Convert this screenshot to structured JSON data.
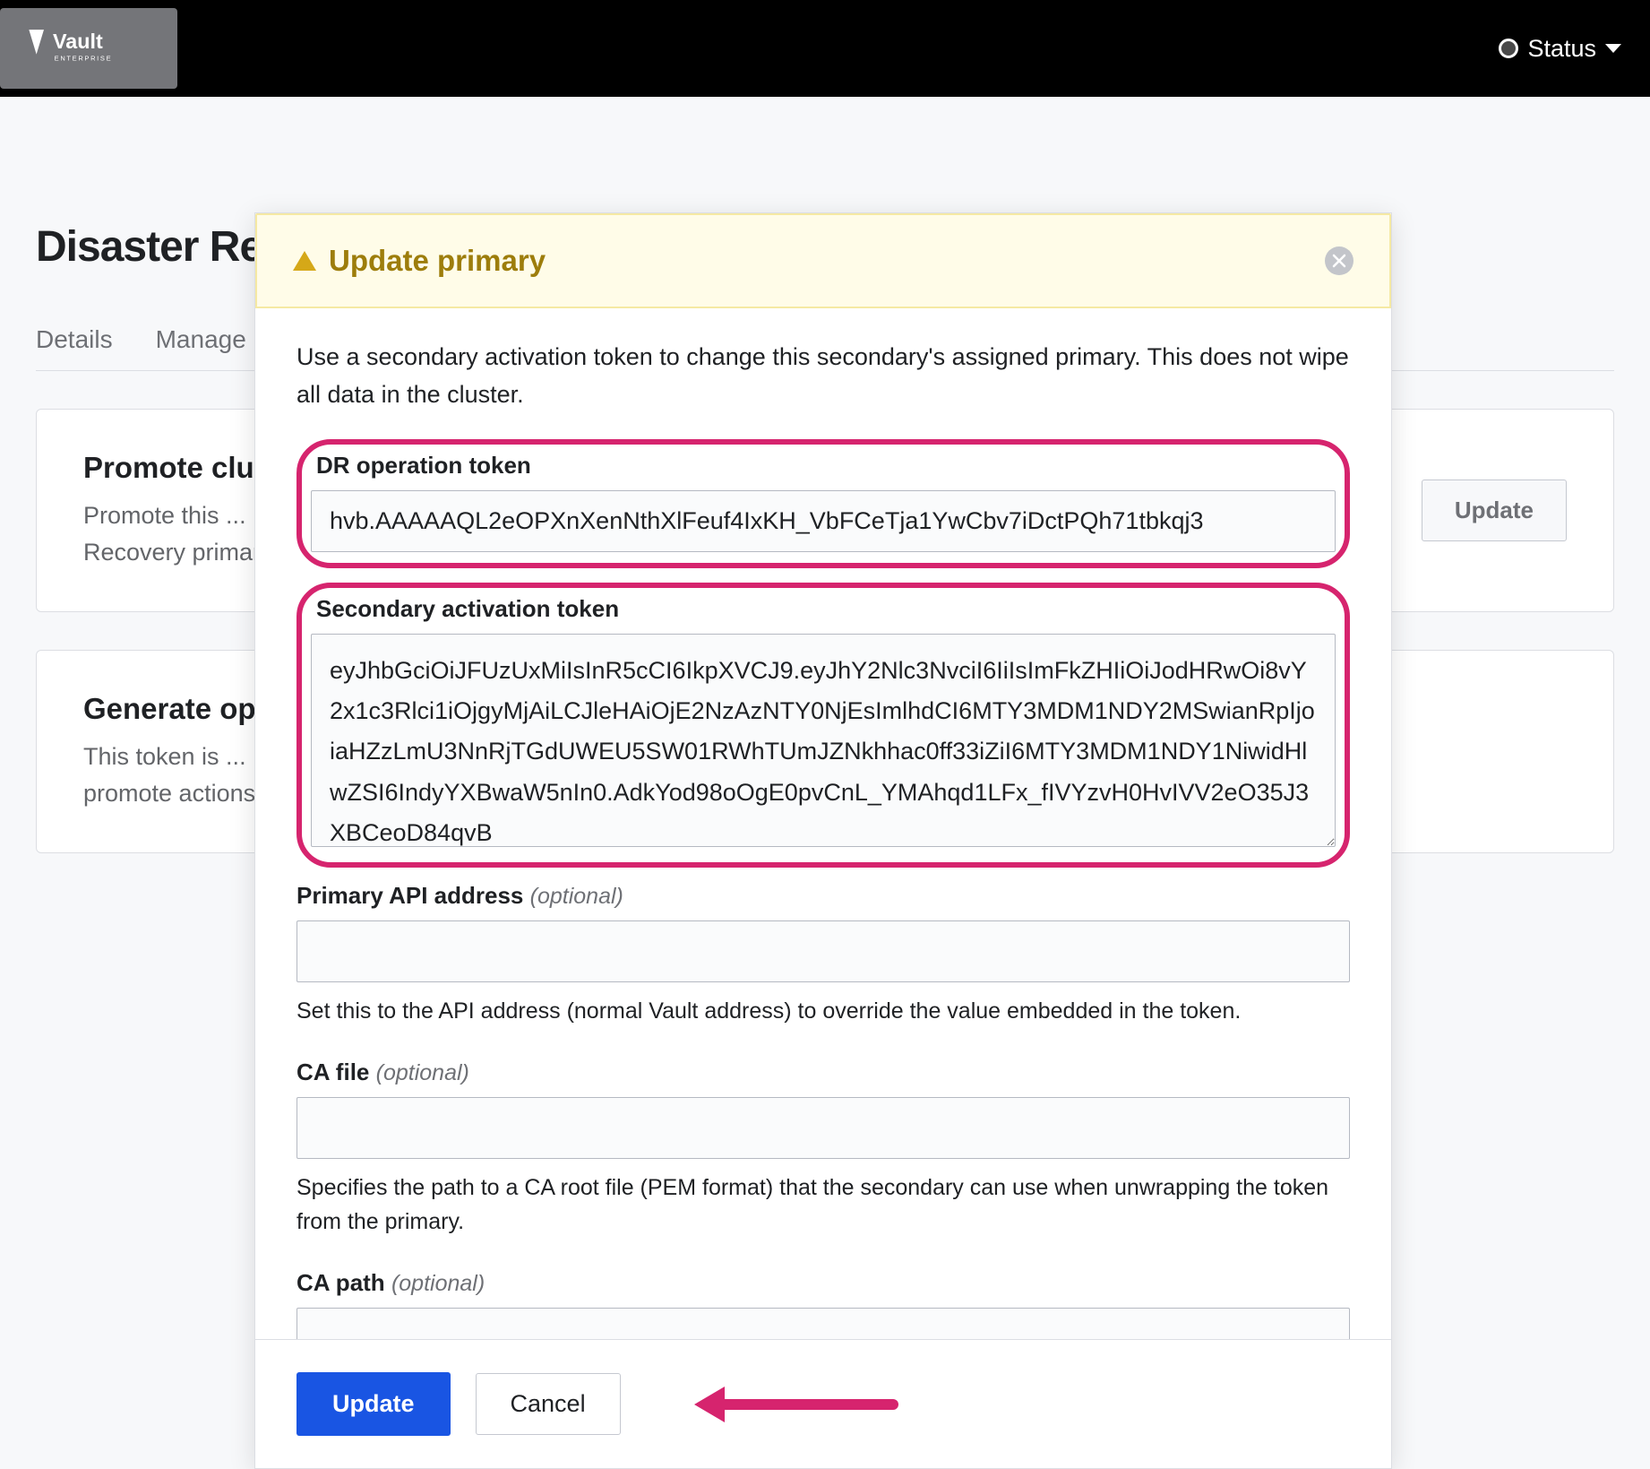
{
  "header": {
    "product": "Vault",
    "subproduct": "ENTERPRISE",
    "status_label": "Status"
  },
  "page": {
    "title": "Disaster Recovery",
    "tabs": [
      "Details",
      "Manage"
    ],
    "cards": [
      {
        "title": "Promote cluster",
        "desc1": "Promote this ...",
        "desc2": "Recovery primary",
        "button": "Update"
      },
      {
        "title": "Generate operation token",
        "desc1": "This token is ...",
        "desc2": "promote actions"
      }
    ]
  },
  "modal": {
    "title": "Update primary",
    "description": "Use a secondary activation token to change this secondary's assigned primary. This does not wipe all data in the cluster.",
    "fields": {
      "dr_token": {
        "label": "DR operation token",
        "value": "hvb.AAAAAQL2eOPXnXenNthXlFeuf4IxKH_VbFCeTja1YwCbv7iDctPQh71tbkqj3"
      },
      "secondary_token": {
        "label": "Secondary activation token",
        "value": "eyJhbGciOiJFUzUxMiIsInR5cCI6IkpXVCJ9.eyJhY2Nlc3NvciI6IiIsImFkZHIiOiJodHRwOi8vY2x1c3Rlci1iOjgyMjAiLCJleHAiOjE2NzAzNTY0NjEsImlhdCI6MTY3MDM1NDY2MSwianRpIjoiaHZzLmU3NnRjTGdUWEU5SW01RWhTUmJZNkhhac0ff33iZiI6MTY3MDM1NDY1NiwidHlwZSI6IndyYXBwaW5nIn0.AdkYod98oOgE0pvCnL_YMAhqd1LFx_fIVYzvH0HvIVV2eO35J3XBCeoD84qvB"
      },
      "api_addr": {
        "label": "Primary API address",
        "optional": "(optional)",
        "help": "Set this to the API address (normal Vault address) to override the value embedded in the token."
      },
      "ca_file": {
        "label": "CA file",
        "optional": "(optional)",
        "help": "Specifies the path to a CA root file (PEM format) that the secondary can use when unwrapping the token from the primary."
      },
      "ca_path": {
        "label": "CA path",
        "optional": "(optional)"
      }
    },
    "buttons": {
      "primary": "Update",
      "secondary": "Cancel"
    }
  }
}
